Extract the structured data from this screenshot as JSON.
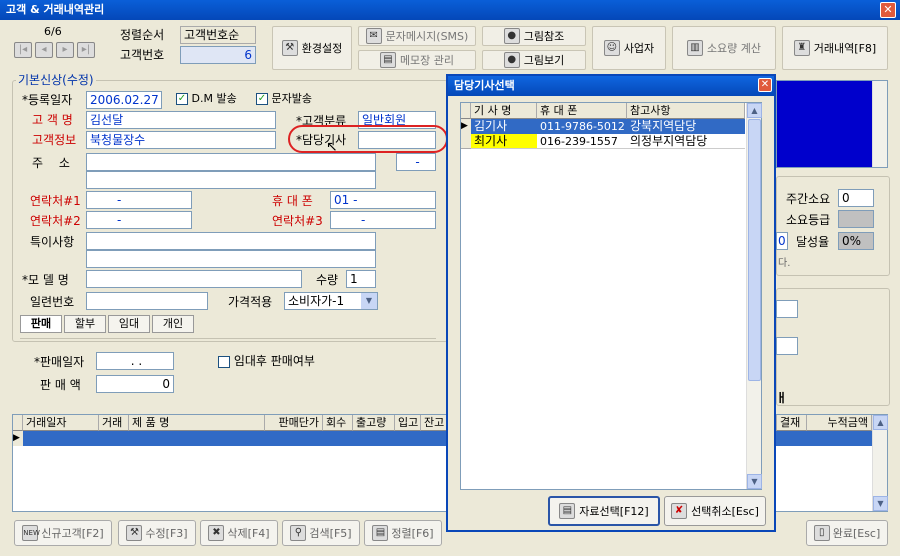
{
  "window": {
    "title": "고객 & 거래내역관리",
    "close": "✕"
  },
  "nav": {
    "counter": "6/6",
    "sort_label": "정렬순서",
    "sort_value": "고객번호순",
    "custno_label": "고객번호",
    "custno_value": "6"
  },
  "toolbar": {
    "env": "환경설정",
    "sms": "문자메시지(SMS)",
    "memo": "메모장 관리",
    "img_ref": "그림참조",
    "img_view": "그림보기",
    "biz": "사업자",
    "usage_calc": "소요량 계산",
    "trade_hist": "거래내역[F8]"
  },
  "form": {
    "section": "기본신상(수정)",
    "reg_date_label": "*등록일자",
    "reg_date": "2006.02.27",
    "dm_label": "D.M 발송",
    "sms_label": "문자발송",
    "name_label": "고 객 명",
    "name": "김선달",
    "class_label": "*고객분류",
    "class_value": "일반회원",
    "info_label": "고객정보",
    "info": "북청물장수",
    "driver_label": "*담당기사",
    "driver": "",
    "addr_label": "주 소",
    "zip": "-",
    "c1_label": "연락처#1",
    "c1": "-",
    "mobile_label": "휴 대 폰",
    "mobile": "01 -",
    "c2_label": "연락처#2",
    "c2": "-",
    "c3_label": "연락처#3",
    "c3": "-",
    "note_label": "특이사항",
    "model_label": "*모 델 명",
    "qty_label": "수량",
    "qty": "1",
    "serial_label": "일련번호",
    "price_label": "가격적용",
    "price_value": "소비자가-1",
    "tabs": [
      "판매",
      "할부",
      "임대",
      "개인"
    ],
    "sale_date_label": "*판매일자",
    "sale_date": ".  .",
    "rental_label": "임대후 판매여부",
    "sale_amt_label": "판 매 액",
    "sale_amt": "0"
  },
  "right": {
    "weekly_label": "주간소요",
    "weekly": "0",
    "grade_label": "소요등급",
    "rate_label": "달성율",
    "rate": "0%",
    "left_zero": "0",
    "da": "다.",
    "h": "ㅐ"
  },
  "grid": {
    "headers": [
      "거래일자",
      "거래",
      "제 품 명",
      "판매단가",
      "회수",
      "출고량",
      "입고",
      "잔고"
    ],
    "right_headers": [
      "결재",
      "누적금액"
    ]
  },
  "bottom": {
    "new": "신규고객[F2]",
    "edit": "수정[F3]",
    "del": "삭제[F4]",
    "search": "검색[F5]",
    "sort": "정렬[F6]",
    "done": "완료[Esc]",
    "new_badge": "NEW"
  },
  "dialog": {
    "title": "담당기사선택",
    "headers": [
      "기 사 명",
      "휴 대 폰",
      "참고사항"
    ],
    "rows": [
      {
        "name": "김기사",
        "phone": "011-9786-5012",
        "note": "강북지역담당"
      },
      {
        "name": "최기사",
        "phone": "016-239-1557",
        "note": "의정부지역담당"
      }
    ],
    "ok": "자료선택[F12]",
    "cancel": "선택취소[Esc]"
  },
  "colors": {
    "selection": "#316ac5",
    "highlight": "#ffff00",
    "blue_panel": "#0000cc",
    "red_circle": "#dd2222"
  }
}
